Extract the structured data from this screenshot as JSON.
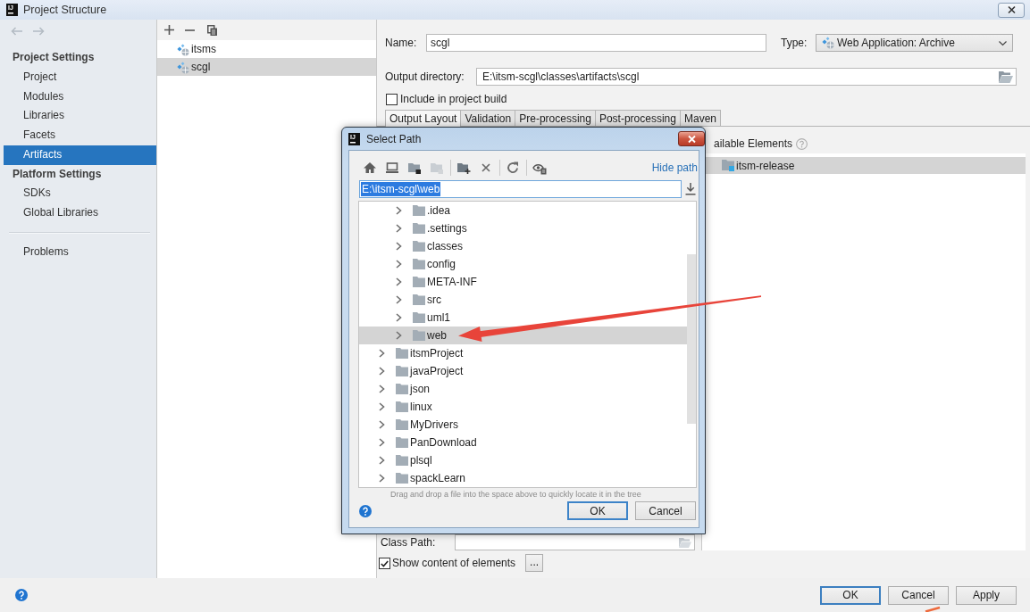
{
  "window": {
    "logo": "IJ",
    "title": "Project Structure"
  },
  "sidebar": {
    "nav": [
      {
        "kind": "back",
        "disabled": true
      },
      {
        "kind": "forward",
        "disabled": true
      }
    ],
    "sections": [
      {
        "heading": "Project Settings",
        "items": [
          {
            "label": "Project",
            "selected": false
          },
          {
            "label": "Modules",
            "selected": false
          },
          {
            "label": "Libraries",
            "selected": false
          },
          {
            "label": "Facets",
            "selected": false
          },
          {
            "label": "Artifacts",
            "selected": true
          }
        ]
      },
      {
        "heading": "Platform Settings",
        "items": [
          {
            "label": "SDKs",
            "selected": false
          },
          {
            "label": "Global Libraries",
            "selected": false
          }
        ]
      },
      {
        "items": [
          {
            "label": "Problems",
            "selected": false
          }
        ]
      }
    ]
  },
  "artifacts": {
    "items": [
      {
        "label": "itsms",
        "selected": false
      },
      {
        "label": "scgl",
        "selected": true
      }
    ]
  },
  "editor": {
    "name": {
      "label": "Name:",
      "value": "scgl"
    },
    "type": {
      "label": "Type:",
      "value": "Web Application: Archive"
    },
    "output_directory": {
      "label": "Output directory:",
      "value": "E:\\itsm-scgl\\classes\\artifacts\\scgl"
    },
    "include_in_build": {
      "label": "Include in project build",
      "checked": false
    },
    "tabs": [
      {
        "label": "Output Layout",
        "selected": true
      },
      {
        "label": "Validation",
        "selected": false
      },
      {
        "label": "Pre-processing",
        "selected": false
      },
      {
        "label": "Post-processing",
        "selected": false
      },
      {
        "label": "Maven",
        "selected": false
      }
    ],
    "available_elements": {
      "heading": "ailable Elements",
      "items": [
        {
          "label": "itsm-release",
          "selected": true
        }
      ]
    },
    "class_path": {
      "label": "Class Path:"
    },
    "show_content": {
      "label": "Show content of elements",
      "checked": true
    },
    "more_button": "..."
  },
  "dialog": {
    "logo": "IJ",
    "title": "Select Path",
    "hide_path": "Hide path",
    "path": {
      "value": "E:\\itsm-scgl\\web",
      "selected": true
    },
    "tree": [
      {
        "children": [
          {
            "label": ".idea",
            "expanded": false,
            "selected": false
          },
          {
            "label": ".settings",
            "expanded": false,
            "selected": false
          },
          {
            "label": "classes",
            "expanded": false,
            "selected": false
          },
          {
            "label": "config",
            "expanded": false,
            "selected": false
          },
          {
            "label": "META-INF",
            "expanded": false,
            "selected": false
          },
          {
            "label": "src",
            "expanded": false,
            "selected": false
          },
          {
            "label": "uml1",
            "expanded": false,
            "selected": false
          },
          {
            "label": "web",
            "expanded": false,
            "selected": true
          }
        ]
      },
      {
        "label": "itsmProject",
        "expanded": false,
        "selected": false
      },
      {
        "label": "javaProject",
        "expanded": false,
        "selected": false
      },
      {
        "label": "json",
        "expanded": false,
        "selected": false
      },
      {
        "label": "linux",
        "expanded": false,
        "selected": false
      },
      {
        "label": "MyDrivers",
        "expanded": false,
        "selected": false
      },
      {
        "label": "PanDownload",
        "expanded": false,
        "selected": false
      },
      {
        "label": "plsql",
        "expanded": false,
        "selected": false
      },
      {
        "label": "spackLearn",
        "expanded": false,
        "selected": false
      }
    ],
    "hint": "Drag and drop a file into the space above to quickly locate it in the tree",
    "buttons": [
      {
        "label": "OK",
        "default": true
      },
      {
        "label": "Cancel",
        "default": false
      }
    ]
  },
  "buttons": [
    {
      "label": "OK",
      "default": true
    },
    {
      "label": "Cancel",
      "default": false
    },
    {
      "label": "Apply",
      "default": false
    }
  ]
}
